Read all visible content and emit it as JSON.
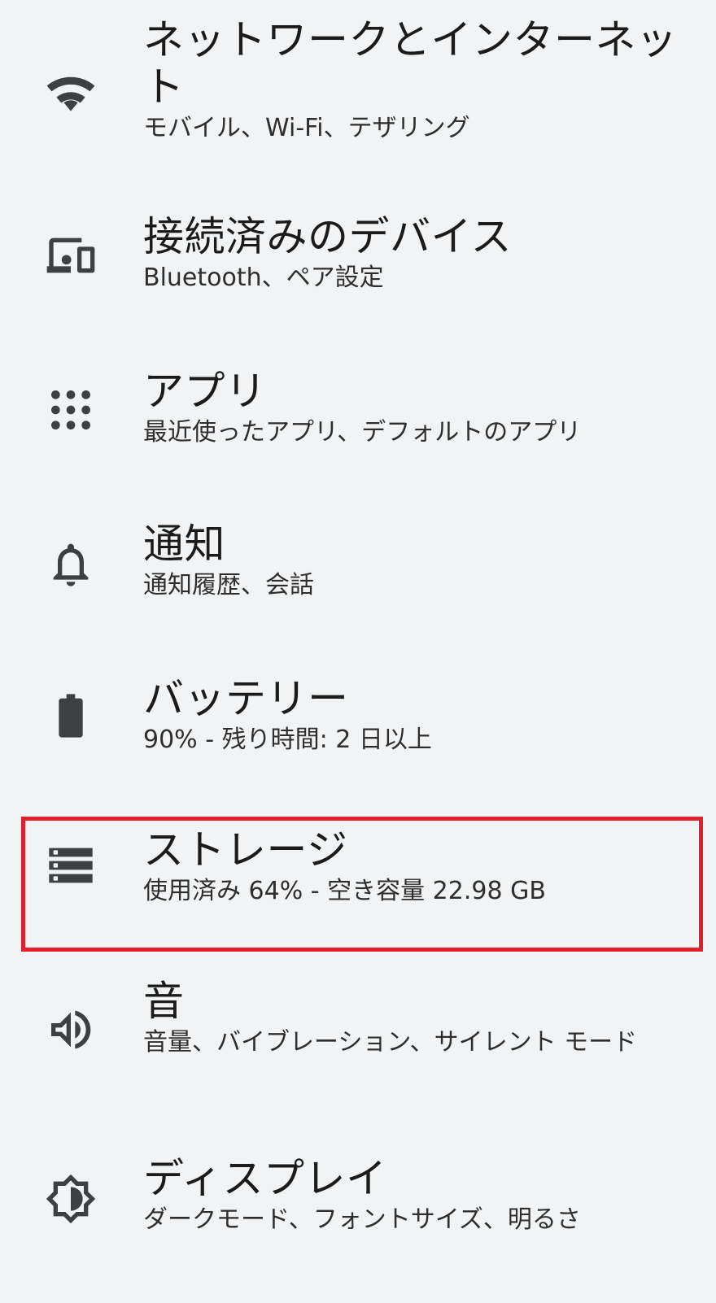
{
  "settings": {
    "items": [
      {
        "id": "network",
        "icon": "wifi-icon",
        "title": "ネットワークとインターネット",
        "summary": "モバイル、Wi-Fi、テザリング"
      },
      {
        "id": "connected-devices",
        "icon": "connected-devices-icon",
        "title": "接続済みのデバイス",
        "summary": "Bluetooth、ペア設定"
      },
      {
        "id": "apps",
        "icon": "apps-grid-icon",
        "title": "アプリ",
        "summary": "最近使ったアプリ、デフォルトのアプリ"
      },
      {
        "id": "notifications",
        "icon": "bell-icon",
        "title": "通知",
        "summary": "通知履歴、会話"
      },
      {
        "id": "battery",
        "icon": "battery-icon",
        "title": "バッテリー",
        "summary": "90% - 残り時間: 2 日以上"
      },
      {
        "id": "storage",
        "icon": "storage-icon",
        "title": "ストレージ",
        "summary": "使用済み 64% - 空き容量 22.98 GB",
        "highlighted": true
      },
      {
        "id": "sound",
        "icon": "volume-icon",
        "title": "音",
        "summary": "音量、バイブレーション、サイレント モード"
      },
      {
        "id": "display",
        "icon": "brightness-icon",
        "title": "ディスプレイ",
        "summary": "ダークモード、フォントサイズ、明るさ"
      }
    ]
  },
  "colors": {
    "background": "#f1f3f4",
    "icon": "#3c4043",
    "highlight_border": "#e0212b"
  }
}
